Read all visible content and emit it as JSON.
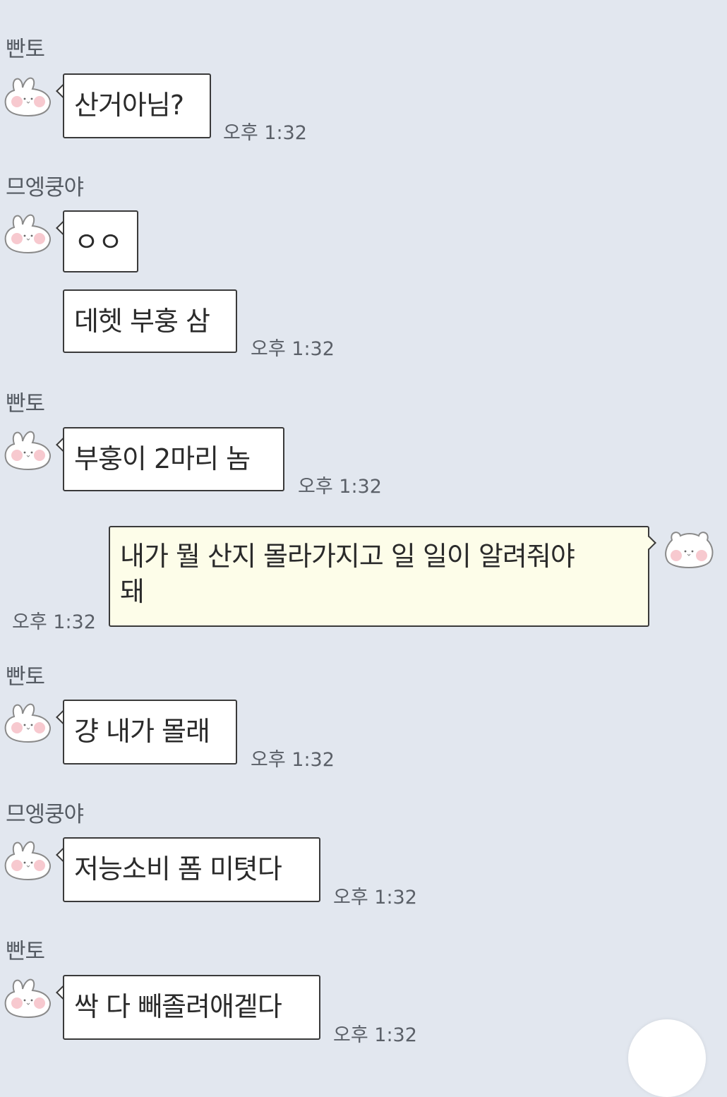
{
  "chat": {
    "messages": [
      {
        "sender": "빤토",
        "text": "산거아님?",
        "time": "오후 1:32"
      },
      {
        "sender": "므엥쿵야",
        "text": "ㅇㅇ"
      },
      {
        "text": "데헷 부훙 삼",
        "time": "오후 1:32"
      },
      {
        "sender": "빤토",
        "text": "부훙이 2마리 놈",
        "time": "오후 1:32"
      },
      {
        "text": "내가 뭘 산지 몰라가지고 일 일이 알려줘야\n돼",
        "time": "오후 1:32",
        "mine": true
      },
      {
        "sender": "빤토",
        "text": "걍 내가 몰래",
        "time": "오후 1:32"
      },
      {
        "sender": "므엥쿵야",
        "text": "저능소비 폼 미텻다",
        "time": "오후 1:32"
      },
      {
        "sender": "빤토",
        "text": "싹 다 빼졸려애겥다",
        "time": "오후 1:32"
      }
    ]
  },
  "icons": {
    "avatar_other": "bunny-avatar-icon",
    "avatar_mine": "bear-avatar-icon"
  },
  "colors": {
    "background": "#e2e7ef",
    "bubble_other": "#ffffff",
    "bubble_mine": "#fdfde9",
    "bubble_border": "#3a3a3a"
  }
}
